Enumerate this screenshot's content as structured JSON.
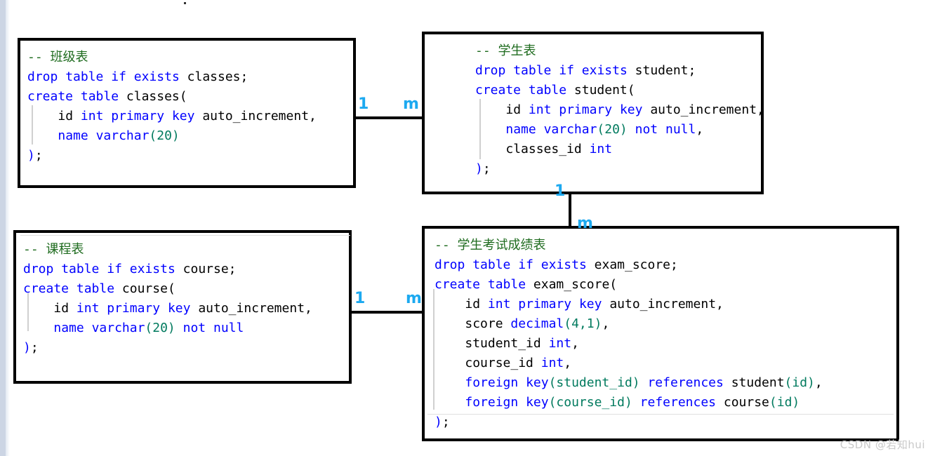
{
  "diagram": {
    "title": "MySQL table creation ER relationships",
    "watermark": "CSDN @若知hui",
    "colors": {
      "keyword": "#0000ff",
      "comment": "#1e6b1e",
      "number": "#007a5e",
      "identifier": "#000000",
      "cardinality": "#1ca9f0",
      "border": "#000000",
      "background": "#ffffff",
      "indent_guide": "#d0d0d0"
    }
  },
  "blocks": {
    "classes": {
      "name": "classes",
      "comment": "-- 班级表",
      "lines": [
        "-- 班级表",
        "drop table if exists classes;",
        "create table classes(",
        "    id int primary key auto_increment,",
        "    name varchar(20)",
        ");"
      ]
    },
    "student": {
      "name": "student",
      "comment": "-- 学生表",
      "lines": [
        "-- 学生表",
        "drop table if exists student;",
        "create table student(",
        "    id int primary key auto_increment,",
        "    name varchar(20) not null,",
        "    classes_id int",
        ");"
      ]
    },
    "course": {
      "name": "course",
      "comment": "-- 课程表",
      "lines": [
        "-- 课程表",
        "drop table if exists course;",
        "create table course(",
        "    id int primary key auto_increment,",
        "    name varchar(20) not null",
        ");"
      ]
    },
    "exam_score": {
      "name": "exam_score",
      "comment": "-- 学生考试成绩表",
      "lines": [
        "-- 学生考试成绩表",
        "drop table if exists exam_score;",
        "create table exam_score(",
        "    id int primary key auto_increment,",
        "    score decimal(4,1),",
        "    student_id int,",
        "    course_id int,",
        "    foreign key(student_id) references student(id),",
        "    foreign key(course_id) references course(id)",
        ");"
      ]
    }
  },
  "relationships": [
    {
      "id": "classes-student",
      "from": "classes",
      "to": "student",
      "from_cardinality": "1",
      "to_cardinality": "m"
    },
    {
      "id": "student-exam_score",
      "from": "student",
      "to": "exam_score",
      "from_cardinality": "1",
      "to_cardinality": "m"
    },
    {
      "id": "course-exam_score",
      "from": "course",
      "to": "exam_score",
      "from_cardinality": "1",
      "to_cardinality": "m"
    }
  ]
}
